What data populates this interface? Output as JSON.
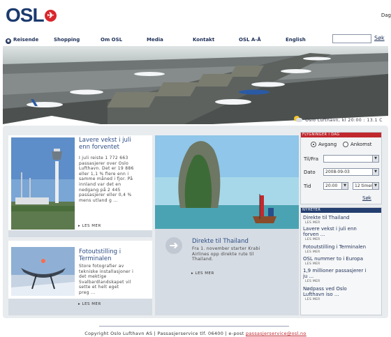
{
  "header": {
    "logo_text": "OSL",
    "top_link": "Dag"
  },
  "nav": {
    "items": [
      "Reisende",
      "Shopping",
      "Om OSL",
      "Media",
      "Kontakt",
      "OSL A-Å",
      "English"
    ],
    "search_button": "Søk"
  },
  "hero": {
    "weather_text": "Oslo Lufthavn, kl 20:00 : 13.1 C"
  },
  "news": [
    {
      "title_lines": [
        "Lavere vekst i juli",
        "enn forventet"
      ],
      "body_lines": [
        "I juli reiste 1 772 663",
        "passasjerer over Oslo",
        "Lufthavn. Det er 19 886",
        "eller 1,1 % flere enn i",
        "samme måned i fjor. På",
        "innland var det en",
        "nedgang på 2 445",
        "passasjerer eller 0,4 %",
        "mens utland g ..."
      ],
      "more": "LES MER"
    },
    {
      "title_lines": [
        "Direkte til Thailand"
      ],
      "body_lines": [
        "Fra 1. november starter Krabi",
        "Airlines opp direkte rute til",
        "Thailand."
      ],
      "more": "LES MER"
    },
    {
      "title_lines": [
        "Fotoutstilling i",
        "Terminalen"
      ],
      "body_lines": [
        "Store fotografier av",
        "tekniske installasjoner i",
        "det mektige",
        "Svalbardlandskapet vil",
        "sette et helt eget",
        "preg ..."
      ],
      "more": "LES MER"
    }
  ],
  "flight_search": {
    "header": "FLYGNINGER I DAG",
    "departure": "Avgang",
    "arrival": "Ankomst",
    "to_from_label": "Til/Fra",
    "to_from_value": "",
    "date_label": "Dato",
    "date_value": "2008-09-03",
    "time_label": "Tid",
    "time_from": "20:00",
    "time_to": "12 timer",
    "search": "Søk"
  },
  "nyheter": {
    "header": "NYHETER",
    "items": [
      {
        "lines": [
          "Direkte til Thailand"
        ],
        "date": "LES MER"
      },
      {
        "lines": [
          "Lavere vekst i juli enn",
          "forven ..."
        ],
        "date": "LES MER"
      },
      {
        "lines": [
          "Fotoutstilling i Terminalen"
        ],
        "date": "LES MER"
      },
      {
        "lines": [
          "OSL nummer to i Europa"
        ],
        "date": "LES MER"
      },
      {
        "lines": [
          "1,9 millioner passasjerer i",
          "ju ..."
        ],
        "date": "LES MER"
      },
      {
        "lines": [
          "Nødpass ved Oslo",
          "Lufthavn iso ..."
        ],
        "date": "LES MER"
      }
    ]
  },
  "footer": {
    "text": "Copyright Oslo Lufthavn AS | Passasjerservice tlf. 06400 | e-post",
    "email": "passasjerservice@osl.no"
  },
  "colors": {
    "brand_navy": "#1a3a6e",
    "brand_red": "#d8262c",
    "box_header_red": "#c0282e",
    "box_header_navy": "#243e70"
  }
}
